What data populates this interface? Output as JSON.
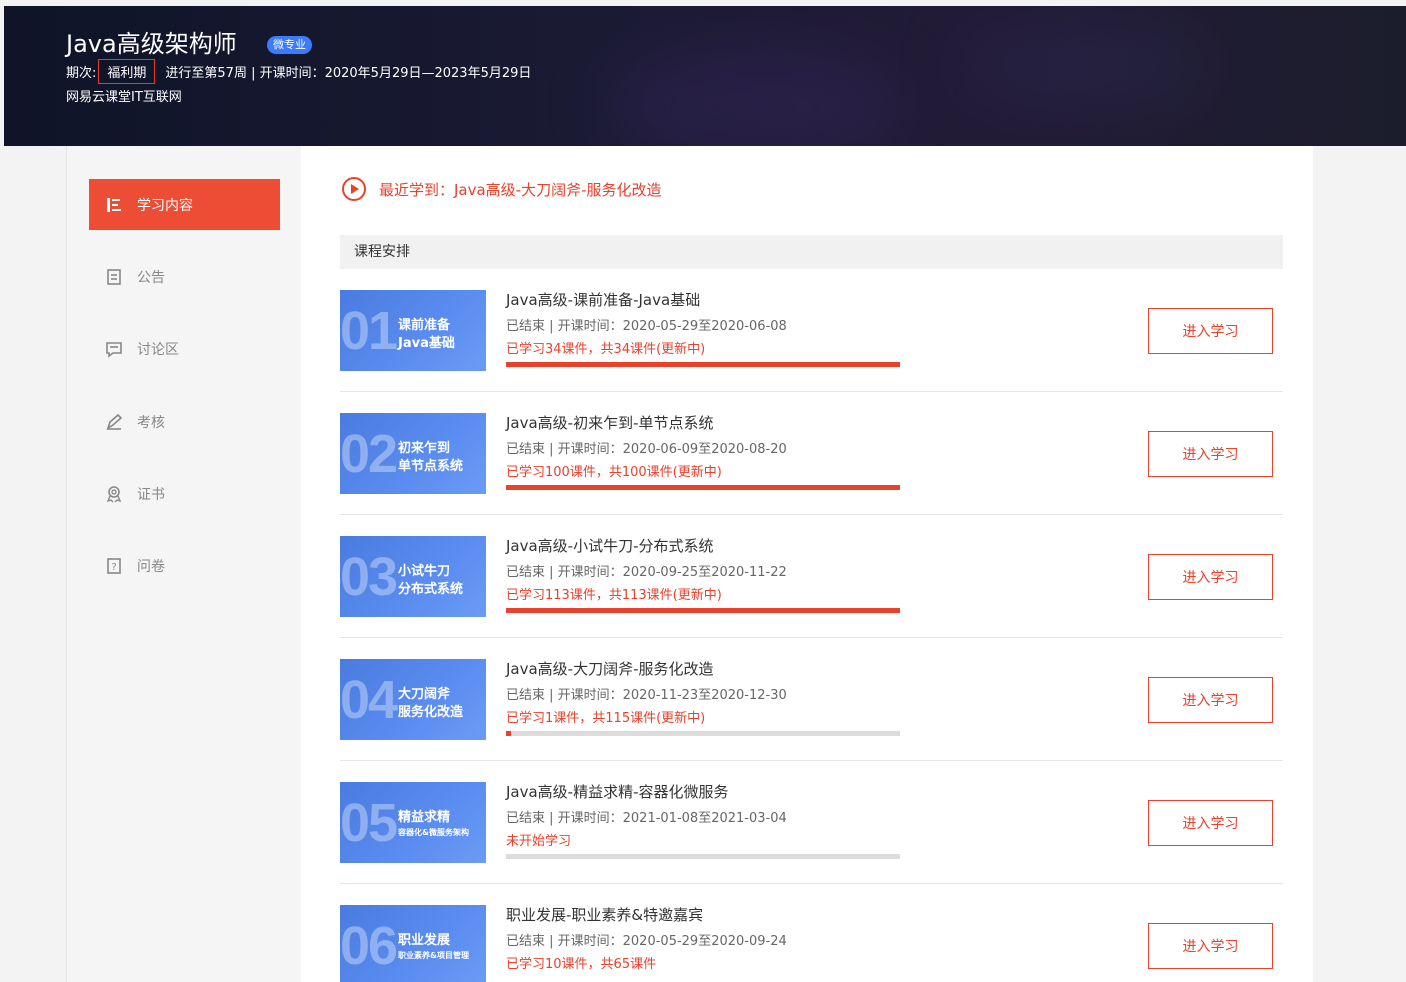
{
  "header": {
    "title": "Java高级架构师",
    "badge": "微专业",
    "period_label": "期次:",
    "period_value": "福利期",
    "progress_text": "进行至第57周 | 开课时间：2020年5月29日—2023年5月29日",
    "org": "网易云课堂IT互联网"
  },
  "sidebar": {
    "items": [
      {
        "label": "学习内容",
        "icon": "study-content-icon",
        "active": true
      },
      {
        "label": "公告",
        "icon": "announcement-icon",
        "active": false
      },
      {
        "label": "讨论区",
        "icon": "discussion-icon",
        "active": false
      },
      {
        "label": "考核",
        "icon": "exam-icon",
        "active": false
      },
      {
        "label": "证书",
        "icon": "certificate-icon",
        "active": false
      },
      {
        "label": "问卷",
        "icon": "questionnaire-icon",
        "active": false
      }
    ]
  },
  "main": {
    "recent": "最近学到：Java高级-大刀阔斧-服务化改造",
    "section_title": "课程安排",
    "enter_label": "进入学习",
    "courses": [
      {
        "num": "01",
        "thumb_line1": "课前准备",
        "thumb_line2": "Java基础",
        "title": "Java高级-课前准备-Java基础",
        "meta": "已结束 | 开课时间：2020-05-29至2020-06-08",
        "progress": "已学习34课件，共34课件(更新中)",
        "fraction": 1.0
      },
      {
        "num": "02",
        "thumb_line1": "初来乍到",
        "thumb_line2": "单节点系统",
        "title": "Java高级-初来乍到-单节点系统",
        "meta": "已结束 | 开课时间：2020-06-09至2020-08-20",
        "progress": "已学习100课件，共100课件(更新中)",
        "fraction": 1.0
      },
      {
        "num": "03",
        "thumb_line1": "小试牛刀",
        "thumb_line2": "分布式系统",
        "title": "Java高级-小试牛刀-分布式系统",
        "meta": "已结束 | 开课时间：2020-09-25至2020-11-22",
        "progress": "已学习113课件，共113课件(更新中)",
        "fraction": 1.0
      },
      {
        "num": "04",
        "thumb_line1": "大刀阔斧",
        "thumb_line2": "服务化改造",
        "title": "Java高级-大刀阔斧-服务化改造",
        "meta": "已结束 | 开课时间：2020-11-23至2020-12-30",
        "progress": "已学习1课件，共115课件(更新中)",
        "fraction": 0.0087
      },
      {
        "num": "05",
        "thumb_line1": "精益求精",
        "thumb_line2": "容器化&微服务架构",
        "title": "Java高级-精益求精-容器化微服务",
        "meta": "已结束 | 开课时间：2021-01-08至2021-03-04",
        "progress": "未开始学习",
        "fraction": 0
      },
      {
        "num": "06",
        "thumb_line1": "职业发展",
        "thumb_line2": "职业素养&项目管理",
        "title": "职业发展-职业素养&特邀嘉宾",
        "meta": "已结束 | 开课时间：2020-05-29至2020-09-24",
        "progress": "已学习10课件，共65课件",
        "fraction": 0.154
      }
    ]
  },
  "colors": {
    "accent": "#e8412c",
    "active_nav": "#ee4d35",
    "thumb_blue": "#5b8cf0"
  }
}
